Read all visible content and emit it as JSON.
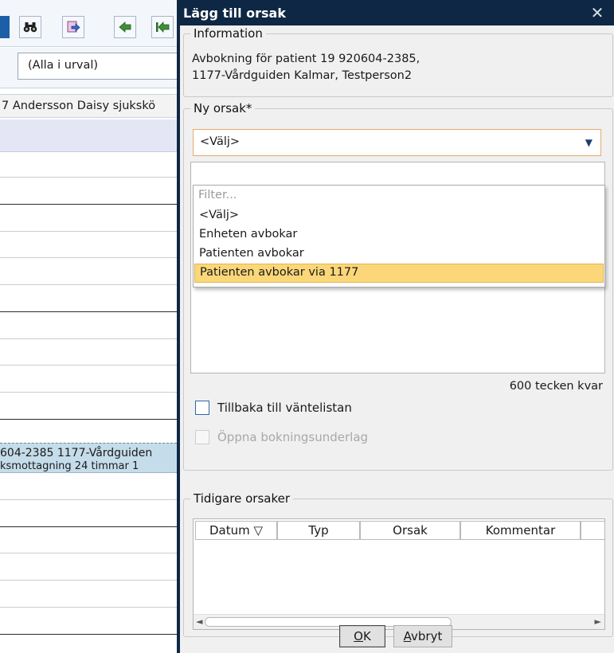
{
  "background": {
    "filter_value": "(Alla i urval)",
    "column_header": "7 Andersson Daisy sjukskö",
    "booking_line1": "604-2385  1177-Vårdguiden",
    "booking_line2": "ksmottagning 24 timmar 1"
  },
  "dialog": {
    "title": "Lägg till orsak",
    "close_symbol": "✕",
    "information": {
      "legend": "Information",
      "line1": "Avbokning för patient 19 920604-2385,",
      "line2": "1177-Vårdguiden Kalmar, Testperson2"
    },
    "new_reason": {
      "legend": "Ny orsak*",
      "selected_value": "<Välj>",
      "dropdown": {
        "filter_placeholder": "Filter...",
        "options": [
          "<Välj>",
          "Enheten avbokar",
          "Patienten avbokar",
          "Patienten avbokar via 1177"
        ],
        "highlighted_option": "Patienten avbokar via 1177"
      },
      "chars_left": "600 tecken kvar",
      "checkbox_waitlist": "Tillbaka till väntelistan",
      "checkbox_booking": "Öppna bokningsunderlag"
    },
    "previous_reasons": {
      "legend": "Tidigare orsaker",
      "columns": [
        "Datum ▽",
        "Typ",
        "Orsak",
        "Kommentar"
      ]
    },
    "buttons": {
      "ok_mnemonic": "O",
      "ok_rest": "K",
      "cancel_mnemonic": "A",
      "cancel_rest": "vbryt"
    }
  },
  "colors": {
    "title_bar": "#0e2744",
    "dialog_body": "#f0f0f0",
    "highlight": "#fbd77a",
    "select_border": "#e8a96a"
  }
}
